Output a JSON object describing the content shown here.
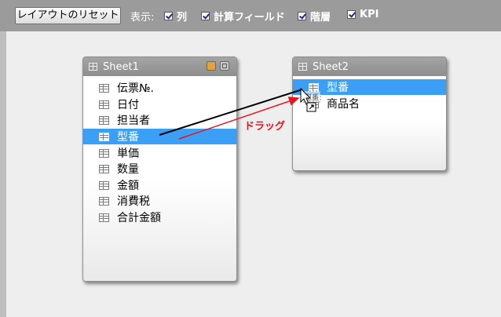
{
  "toolbar": {
    "reset_label": "レイアウトのリセット",
    "show_label": "表示:",
    "options": [
      {
        "label": "列",
        "checked": true
      },
      {
        "label": "計算フィールド",
        "checked": true
      },
      {
        "label": "階層",
        "checked": true
      },
      {
        "label": "KPI",
        "checked": true
      }
    ]
  },
  "tables": [
    {
      "title": "Sheet1",
      "fields": [
        "伝票№.",
        "日付",
        "担当者",
        "型番",
        "単価",
        "数量",
        "金額",
        "消費税",
        "合計金額"
      ],
      "selected": "型番"
    },
    {
      "title": "Sheet2",
      "fields": [
        "型番",
        "商品名"
      ],
      "selected": "型番"
    }
  ],
  "annotation": {
    "text": "ドラッグ",
    "color": "#e8141c"
  },
  "colors": {
    "selection": "#3a9ff5",
    "toolbar": "#9b9b9b",
    "arrow_black": "#000000"
  },
  "drag_ghost_label": "型番"
}
